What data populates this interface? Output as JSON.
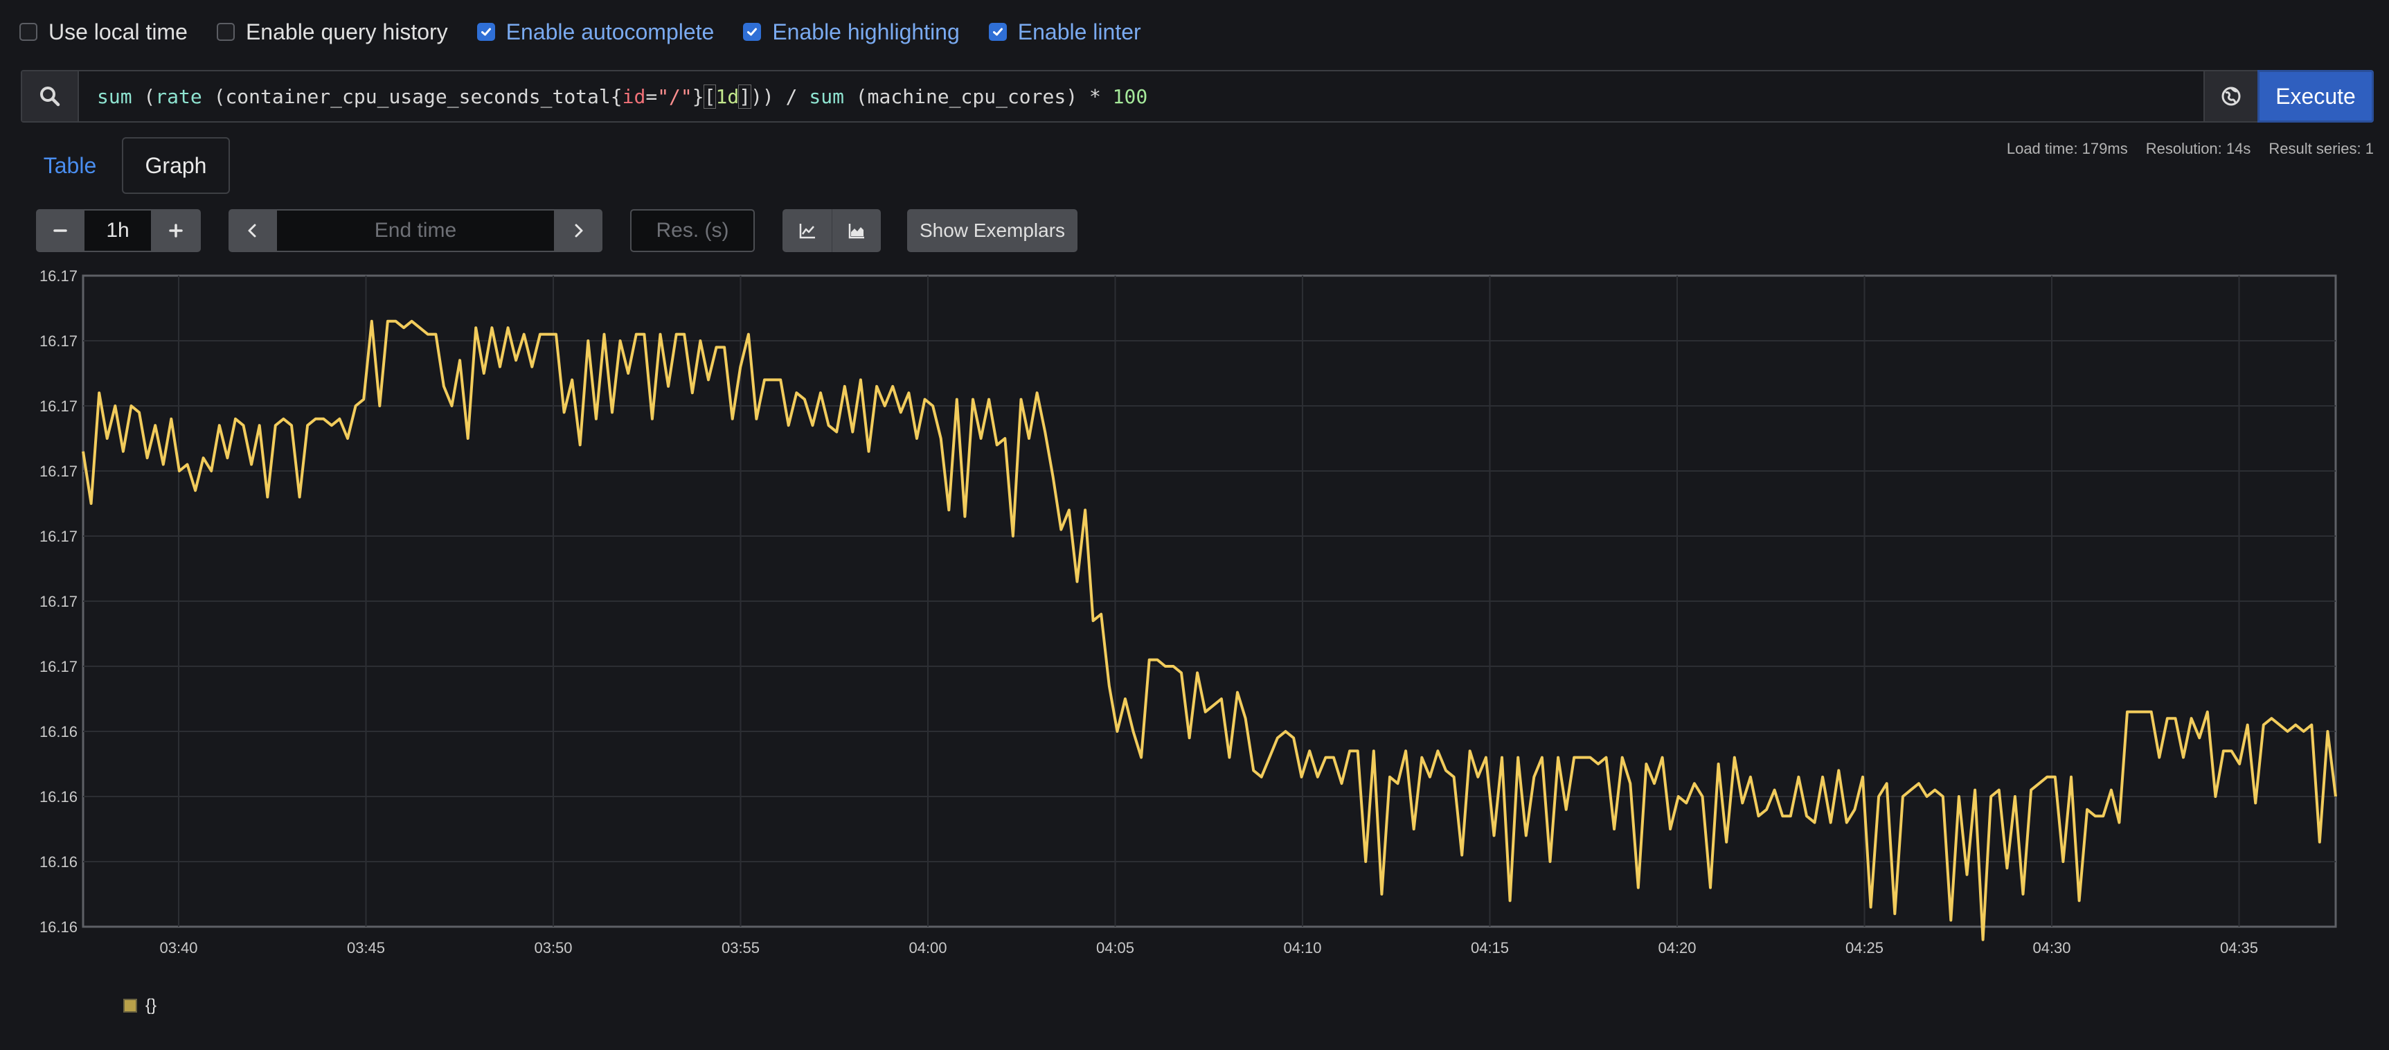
{
  "options": [
    {
      "label": "Use local time",
      "checked": false
    },
    {
      "label": "Enable query history",
      "checked": false
    },
    {
      "label": "Enable autocomplete",
      "checked": true
    },
    {
      "label": "Enable highlighting",
      "checked": true
    },
    {
      "label": "Enable linter",
      "checked": true
    }
  ],
  "query": {
    "t1": "sum",
    "t2": " (",
    "t3": "rate",
    "t4": " (container_cpu_usage_seconds_total{",
    "t5": "id",
    "t6": "=",
    "t7": "\"/\"",
    "t8": "}",
    "t9": "[",
    "t10": "1d",
    "t11": "]",
    "t12": ")) / ",
    "t13": "sum",
    "t14": " (machine_cpu_cores) * ",
    "t15": "100"
  },
  "execute_label": "Execute",
  "tabs": {
    "table": "Table",
    "graph": "Graph"
  },
  "stats": {
    "load": "Load time: 179ms",
    "resolution": "Resolution: 14s",
    "series": "Result series: 1"
  },
  "controls": {
    "range_value": "1h",
    "end_placeholder": "End time",
    "res_placeholder": "Res. (s)",
    "exemplars_label": "Show Exemplars"
  },
  "icons": {
    "search": "search-icon",
    "globe": "globe-icon",
    "minus": "minus-icon",
    "plus": "plus-icon",
    "prev": "chevron-left-icon",
    "next": "chevron-right-icon",
    "line": "line-chart-icon",
    "stacked": "stacked-chart-icon"
  },
  "colors": {
    "accent": "#2f5fbf",
    "series": "#f2cc5c",
    "link": "#4a8ef0"
  },
  "chart_data": {
    "type": "line",
    "y_tick_labels": [
      "16.17",
      "16.17",
      "16.17",
      "16.17",
      "16.17",
      "16.17",
      "16.17",
      "16.16",
      "16.16",
      "16.16",
      "16.16"
    ],
    "x_tick_labels": [
      "03:40",
      "03:45",
      "03:50",
      "03:55",
      "04:00",
      "04:05",
      "04:10",
      "04:15",
      "04:20",
      "04:25",
      "04:30",
      "04:35"
    ],
    "grid": true,
    "legend": "bottom-left",
    "series": [
      {
        "name": "{}",
        "values": [
          0.73,
          0.65,
          0.82,
          0.75,
          0.8,
          0.73,
          0.8,
          0.79,
          0.72,
          0.77,
          0.71,
          0.78,
          0.7,
          0.71,
          0.67,
          0.72,
          0.7,
          0.77,
          0.72,
          0.78,
          0.77,
          0.71,
          0.77,
          0.66,
          0.77,
          0.78,
          0.77,
          0.66,
          0.77,
          0.78,
          0.78,
          0.77,
          0.78,
          0.75,
          0.8,
          0.81,
          0.93,
          0.8,
          0.93,
          0.93,
          0.92,
          0.93,
          0.92,
          0.91,
          0.91,
          0.83,
          0.8,
          0.87,
          0.75,
          0.92,
          0.85,
          0.92,
          0.86,
          0.92,
          0.87,
          0.91,
          0.86,
          0.91,
          0.91,
          0.91,
          0.79,
          0.84,
          0.74,
          0.9,
          0.78,
          0.91,
          0.79,
          0.9,
          0.85,
          0.91,
          0.91,
          0.78,
          0.91,
          0.83,
          0.91,
          0.91,
          0.82,
          0.9,
          0.84,
          0.89,
          0.89,
          0.78,
          0.86,
          0.91,
          0.78,
          0.84,
          0.84,
          0.84,
          0.77,
          0.82,
          0.81,
          0.77,
          0.82,
          0.77,
          0.76,
          0.83,
          0.76,
          0.84,
          0.73,
          0.83,
          0.8,
          0.83,
          0.79,
          0.82,
          0.75,
          0.81,
          0.8,
          0.75,
          0.64,
          0.81,
          0.63,
          0.81,
          0.75,
          0.81,
          0.74,
          0.75,
          0.6,
          0.81,
          0.75,
          0.82,
          0.76,
          0.69,
          0.61,
          0.64,
          0.53,
          0.64,
          0.47,
          0.48,
          0.37,
          0.3,
          0.35,
          0.3,
          0.26,
          0.41,
          0.41,
          0.4,
          0.4,
          0.39,
          0.29,
          0.39,
          0.33,
          0.34,
          0.35,
          0.26,
          0.36,
          0.32,
          0.24,
          0.23,
          0.26,
          0.29,
          0.3,
          0.29,
          0.23,
          0.27,
          0.23,
          0.26,
          0.26,
          0.22,
          0.27,
          0.27,
          0.1,
          0.27,
          0.05,
          0.23,
          0.22,
          0.27,
          0.15,
          0.26,
          0.23,
          0.27,
          0.24,
          0.23,
          0.11,
          0.27,
          0.23,
          0.26,
          0.14,
          0.26,
          0.04,
          0.26,
          0.14,
          0.23,
          0.26,
          0.1,
          0.26,
          0.18,
          0.26,
          0.26,
          0.26,
          0.25,
          0.26,
          0.15,
          0.26,
          0.22,
          0.06,
          0.25,
          0.22,
          0.26,
          0.15,
          0.2,
          0.19,
          0.22,
          0.2,
          0.06,
          0.25,
          0.13,
          0.26,
          0.19,
          0.23,
          0.17,
          0.18,
          0.21,
          0.17,
          0.17,
          0.23,
          0.17,
          0.16,
          0.23,
          0.16,
          0.24,
          0.16,
          0.18,
          0.23,
          0.03,
          0.2,
          0.22,
          0.02,
          0.2,
          0.21,
          0.22,
          0.2,
          0.21,
          0.2,
          0.01,
          0.2,
          0.08,
          0.21,
          -0.02,
          0.2,
          0.21,
          0.09,
          0.2,
          0.05,
          0.21,
          0.22,
          0.23,
          0.23,
          0.1,
          0.23,
          0.04,
          0.18,
          0.17,
          0.17,
          0.21,
          0.16,
          0.33,
          0.33,
          0.33,
          0.33,
          0.26,
          0.32,
          0.32,
          0.26,
          0.32,
          0.29,
          0.33,
          0.2,
          0.27,
          0.27,
          0.25,
          0.31,
          0.19,
          0.31,
          0.32,
          0.31,
          0.3,
          0.31,
          0.3,
          0.31,
          0.13,
          0.3,
          0.2
        ]
      }
    ]
  }
}
